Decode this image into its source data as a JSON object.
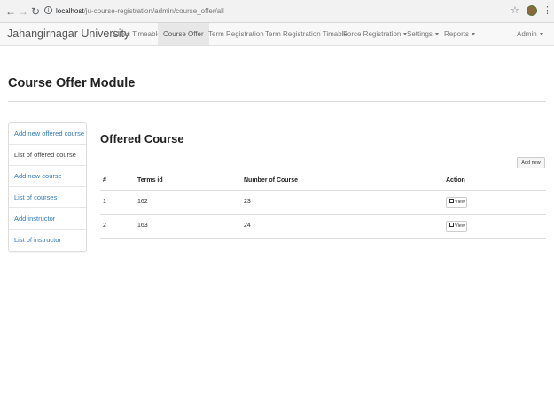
{
  "browser": {
    "url_host": "localhost",
    "url_path": "/ju-course-registration/admin/course_offer/all",
    "back_icon": "arrow-left-icon",
    "forward_icon": "arrow-right-icon",
    "reload_icon": "reload-icon"
  },
  "navbar": {
    "brand": "Jahangirnagar University",
    "items": [
      {
        "label": "Class Timeable"
      },
      {
        "label": "Course Offer"
      },
      {
        "label": "Term Registration"
      },
      {
        "label": "Term Registration Timable"
      },
      {
        "label": "Force Registration"
      },
      {
        "label": "Settings"
      },
      {
        "label": "Reports"
      },
      {
        "label": "Admin"
      }
    ]
  },
  "page": {
    "title": "Course Offer Module"
  },
  "sidebar": {
    "items": [
      {
        "label": "Add new offered course"
      },
      {
        "label": "List of offered course"
      },
      {
        "label": "Add new course"
      },
      {
        "label": "List of courses"
      },
      {
        "label": "Add instructor"
      },
      {
        "label": "List of instructor"
      }
    ]
  },
  "main": {
    "title": "Offered Course",
    "add_new_label": "Add new",
    "columns": [
      "#",
      "Terms id",
      "Number of Course",
      "Action"
    ],
    "rows": [
      {
        "num": "1",
        "term_id": "162",
        "courses": "23",
        "action": "View"
      },
      {
        "num": "2",
        "term_id": "163",
        "courses": "24",
        "action": "View"
      }
    ]
  },
  "colors": {
    "link": "#337ab7",
    "navbar_bg": "#f8f8f8",
    "active_tab_bg": "#e7e7e7"
  }
}
